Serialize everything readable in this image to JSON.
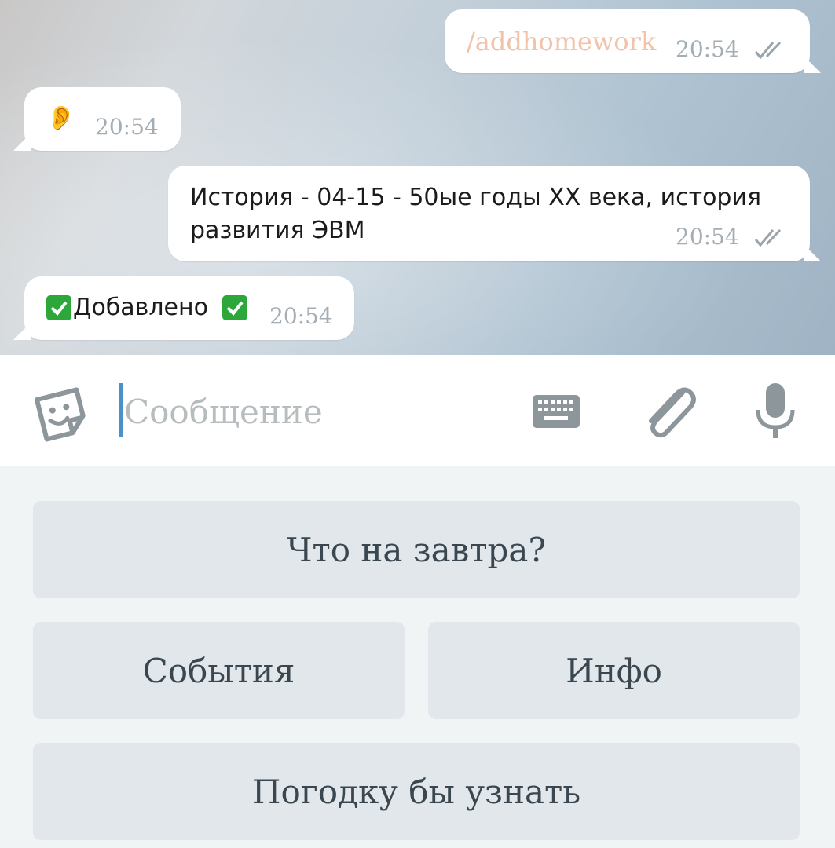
{
  "messages": [
    {
      "text": "/addhomework",
      "time": "20:54"
    },
    {
      "emoji": "👂",
      "time": "20:54"
    },
    {
      "line1": "История - 04-15 - 50ые годы XX века, история",
      "line2": "развития ЭВМ",
      "time": "20:54"
    },
    {
      "text": "Добавлено",
      "time": "20:54"
    }
  ],
  "composer": {
    "placeholder": "Сообщение"
  },
  "keyboard": {
    "buttons": [
      "Что на завтра?",
      "События",
      "Инфо",
      "Погодку бы узнать"
    ]
  },
  "colors": {
    "bubble": "#ffffff",
    "command_text": "#f0c3aa",
    "check_green": "#2ea73a",
    "caret": "#4a90c9",
    "keyboard_bg": "#f0f4f5",
    "keyboard_button": "#e1e7ea"
  },
  "icons": [
    "double-check-icon",
    "ear-emoji",
    "check-mark-emoji",
    "sticker-smiley-icon",
    "keyboard-icon",
    "paperclip-icon",
    "microphone-icon"
  ]
}
